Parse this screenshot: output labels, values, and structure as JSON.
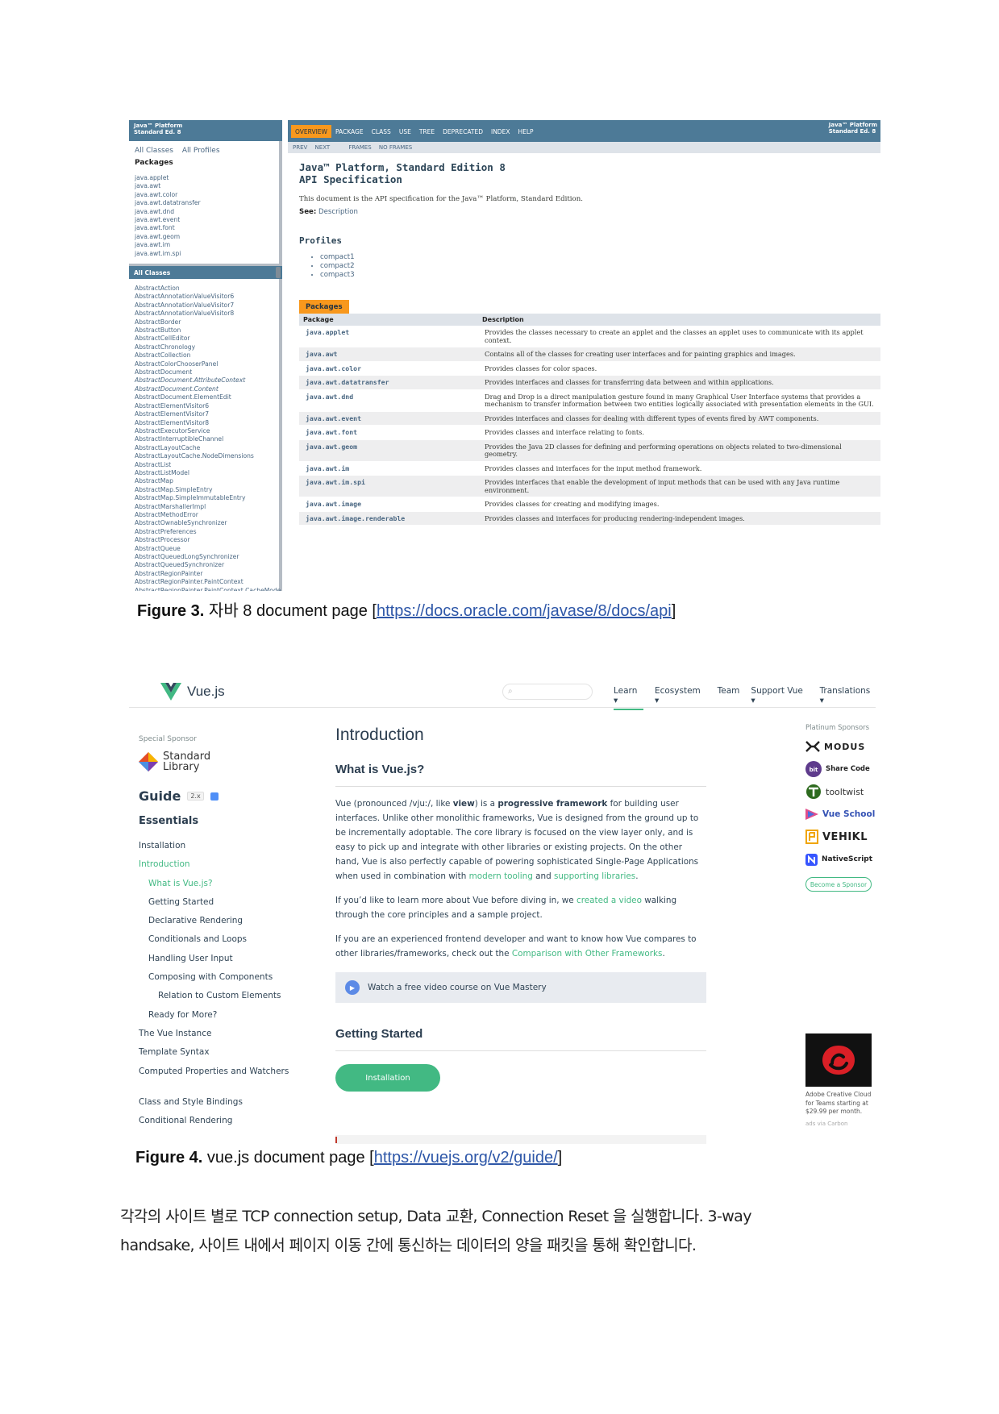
{
  "figure3": {
    "left": {
      "brand_line1": "Java™ Platform",
      "brand_line2": "Standard Ed. 8",
      "all_classes": "All Classes",
      "all_profiles": "All Profiles",
      "packages_heading": "Packages",
      "packages": [
        "java.applet",
        "java.awt",
        "java.awt.color",
        "java.awt.datatransfer",
        "java.awt.dnd",
        "java.awt.event",
        "java.awt.font",
        "java.awt.geom",
        "java.awt.im",
        "java.awt.im.spi"
      ],
      "all_classes_heading": "All Classes",
      "classes": [
        {
          "name": "AbstractAction",
          "italic": false
        },
        {
          "name": "AbstractAnnotationValueVisitor6",
          "italic": false
        },
        {
          "name": "AbstractAnnotationValueVisitor7",
          "italic": false
        },
        {
          "name": "AbstractAnnotationValueVisitor8",
          "italic": false
        },
        {
          "name": "AbstractBorder",
          "italic": false
        },
        {
          "name": "AbstractButton",
          "italic": false
        },
        {
          "name": "AbstractCellEditor",
          "italic": false
        },
        {
          "name": "AbstractChronology",
          "italic": false
        },
        {
          "name": "AbstractCollection",
          "italic": false
        },
        {
          "name": "AbstractColorChooserPanel",
          "italic": false
        },
        {
          "name": "AbstractDocument",
          "italic": false
        },
        {
          "name": "AbstractDocument.AttributeContext",
          "italic": true
        },
        {
          "name": "AbstractDocument.Content",
          "italic": true
        },
        {
          "name": "AbstractDocument.ElementEdit",
          "italic": false
        },
        {
          "name": "AbstractElementVisitor6",
          "italic": false
        },
        {
          "name": "AbstractElementVisitor7",
          "italic": false
        },
        {
          "name": "AbstractElementVisitor8",
          "italic": false
        },
        {
          "name": "AbstractExecutorService",
          "italic": false
        },
        {
          "name": "AbstractInterruptibleChannel",
          "italic": false
        },
        {
          "name": "AbstractLayoutCache",
          "italic": false
        },
        {
          "name": "AbstractLayoutCache.NodeDimensions",
          "italic": false
        },
        {
          "name": "AbstractList",
          "italic": false
        },
        {
          "name": "AbstractListModel",
          "italic": false
        },
        {
          "name": "AbstractMap",
          "italic": false
        },
        {
          "name": "AbstractMap.SimpleEntry",
          "italic": false
        },
        {
          "name": "AbstractMap.SimpleImmutableEntry",
          "italic": false
        },
        {
          "name": "AbstractMarshallerImpl",
          "italic": false
        },
        {
          "name": "AbstractMethodError",
          "italic": false
        },
        {
          "name": "AbstractOwnableSynchronizer",
          "italic": false
        },
        {
          "name": "AbstractPreferences",
          "italic": false
        },
        {
          "name": "AbstractProcessor",
          "italic": false
        },
        {
          "name": "AbstractQueue",
          "italic": false
        },
        {
          "name": "AbstractQueuedLongSynchronizer",
          "italic": false
        },
        {
          "name": "AbstractQueuedSynchronizer",
          "italic": false
        },
        {
          "name": "AbstractRegionPainter",
          "italic": false
        },
        {
          "name": "AbstractRegionPainter.PaintContext",
          "italic": false
        },
        {
          "name": "AbstractRegionPainter.PaintContext.CacheMode",
          "italic": false
        }
      ]
    },
    "right": {
      "nav": [
        "OVERVIEW",
        "PACKAGE",
        "CLASS",
        "USE",
        "TREE",
        "DEPRECATED",
        "INDEX",
        "HELP"
      ],
      "brand_line1": "Java™ Platform",
      "brand_line2": "Standard Ed. 8",
      "prev": "PREV",
      "next": "NEXT",
      "frames": "FRAMES",
      "no_frames": "NO FRAMES",
      "title_line1": "Java™ Platform, Standard Edition 8",
      "title_line2": "API Specification",
      "intro": "This document is the API specification for the Java™ Platform, Standard Edition.",
      "see_label": "See:",
      "see_link": "Description",
      "profiles_heading": "Profiles",
      "profiles": [
        "compact1",
        "compact2",
        "compact3"
      ],
      "packages_tab": "Packages",
      "col_package": "Package",
      "col_description": "Description",
      "rows": [
        {
          "pkg": "java.applet",
          "desc": "Provides the classes necessary to create an applet and the classes an applet uses to communicate with its applet context."
        },
        {
          "pkg": "java.awt",
          "desc": "Contains all of the classes for creating user interfaces and for painting graphics and images."
        },
        {
          "pkg": "java.awt.color",
          "desc": "Provides classes for color spaces."
        },
        {
          "pkg": "java.awt.datatransfer",
          "desc": "Provides interfaces and classes for transferring data between and within applications."
        },
        {
          "pkg": "java.awt.dnd",
          "desc": "Drag and Drop is a direct manipulation gesture found in many Graphical User Interface systems that provides a mechanism to transfer information between two entities logically associated with presentation elements in the GUI."
        },
        {
          "pkg": "java.awt.event",
          "desc": "Provides interfaces and classes for dealing with different types of events fired by AWT components."
        },
        {
          "pkg": "java.awt.font",
          "desc": "Provides classes and interface relating to fonts."
        },
        {
          "pkg": "java.awt.geom",
          "desc": "Provides the Java 2D classes for defining and performing operations on objects related to two-dimensional geometry."
        },
        {
          "pkg": "java.awt.im",
          "desc": "Provides classes and interfaces for the input method framework."
        },
        {
          "pkg": "java.awt.im.spi",
          "desc": "Provides interfaces that enable the development of input methods that can be used with any Java runtime environment."
        },
        {
          "pkg": "java.awt.image",
          "desc": "Provides classes for creating and modifying images."
        },
        {
          "pkg": "java.awt.image.renderable",
          "desc": "Provides classes and interfaces for producing rendering-independent images."
        }
      ]
    },
    "caption_label": "Figure 3.",
    "caption_text": " 자바 8 document page [",
    "caption_link": "https://docs.oracle.com/javase/8/docs/api",
    "caption_end": "]"
  },
  "figure4": {
    "logo_text": "Vue.js",
    "nav": [
      "Learn ▾",
      "Ecosystem ▾",
      "Team",
      "Support Vue ▾",
      "Translations ▾"
    ],
    "special_sponsor_label": "Special Sponsor",
    "special_sponsor_line1": "Standard",
    "special_sponsor_line2": "Library",
    "guide": "Guide",
    "version": "2.x",
    "essentials": "Essentials",
    "menu": [
      {
        "label": "Installation",
        "level": 1,
        "active": false
      },
      {
        "label": "Introduction",
        "level": 1,
        "active": true
      },
      {
        "label": "What is Vue.js?",
        "level": 2,
        "active": true
      },
      {
        "label": "Getting Started",
        "level": 2,
        "active": false
      },
      {
        "label": "Declarative Rendering",
        "level": 2,
        "active": false
      },
      {
        "label": "Conditionals and Loops",
        "level": 2,
        "active": false
      },
      {
        "label": "Handling User Input",
        "level": 2,
        "active": false
      },
      {
        "label": "Composing with Components",
        "level": 2,
        "active": false
      },
      {
        "label": "Relation to Custom Elements",
        "level": 3,
        "active": false
      },
      {
        "label": "Ready for More?",
        "level": 2,
        "active": false
      },
      {
        "label": "The Vue Instance",
        "level": 1,
        "active": false
      },
      {
        "label": "Template Syntax",
        "level": 1,
        "active": false
      },
      {
        "label": "Computed Properties and Watchers",
        "level": 1,
        "active": false,
        "wrap": true
      },
      {
        "label": "Class and Style Bindings",
        "level": 1,
        "active": false
      },
      {
        "label": "Conditional Rendering",
        "level": 1,
        "active": false
      }
    ],
    "h1": "Introduction",
    "h2": "What is Vue.js?",
    "p1_a": "Vue (pronounced /vjuː/, like ",
    "p1_view": "view",
    "p1_b": ") is a ",
    "p1_pf": "progressive framework",
    "p1_c": " for building user interfaces. Unlike other monolithic frameworks, Vue is designed from the ground up to be incrementally adoptable. The core library is focused on the view layer only, and is easy to pick up and integrate with other libraries or existing projects. On the other hand, Vue is also perfectly capable of powering sophisticated Single-Page Applications when used in combination with ",
    "p1_link1": "modern tooling",
    "p1_and": " and ",
    "p1_link2": "supporting libraries",
    "p1_end": ".",
    "p2_a": "If you’d like to learn more about Vue before diving in, we ",
    "p2_link": "created a video",
    "p2_b": " walking through the core principles and a sample project.",
    "p3_a": "If you are an experienced frontend developer and want to know how Vue compares to other libraries/frameworks, check out the ",
    "p3_link": "Comparison with Other Frameworks",
    "p3_end": ".",
    "video_text": "Watch a free video course on Vue Mastery",
    "getting_started": "Getting Started",
    "install_button": "Installation",
    "platinum_label": "Platinum Sponsors",
    "sponsors": [
      "MODUS",
      "Share Code",
      "tooltwist",
      "Vue School",
      "VEHIKL",
      "NativeScript"
    ],
    "become_sponsor": "Become a Sponsor",
    "ad_text": "Adobe Creative Cloud for Teams starting at $29.99 per month.",
    "ad_via": "ads via Carbon",
    "caption_label": "Figure 4.",
    "caption_text": " vue.js document page [",
    "caption_link": "https://vuejs.org/v2/guide/",
    "caption_end": "]"
  },
  "body_text": {
    "line1": "각각의 사이트 별로 TCP connection setup, Data 교환, Connection Reset 을 실행합니다. 3-way",
    "line2": "handsake, 사이트 내에서 페이지 이동 간에 통신하는 데이터의 양을 패킷을 통해 확인합니다."
  }
}
